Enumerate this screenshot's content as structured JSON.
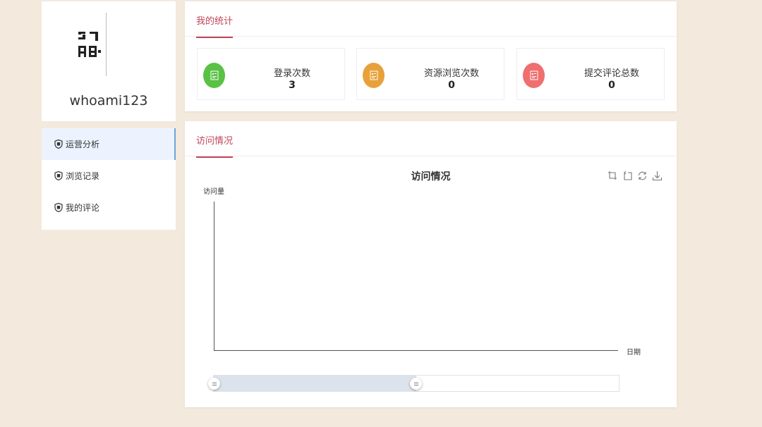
{
  "profile": {
    "username": "whoami123",
    "avatar_icon": "qr-avatar-icon"
  },
  "menu": {
    "items": [
      {
        "label": "运营分析",
        "icon": "shield-icon",
        "active": true
      },
      {
        "label": "浏览记录",
        "icon": "shield-icon",
        "active": false
      },
      {
        "label": "我的评论",
        "icon": "shield-icon",
        "active": false
      }
    ]
  },
  "stats": {
    "tab_label": "我的统计",
    "cards": [
      {
        "label": "登录次数",
        "value": "3",
        "color": "#59c144",
        "icon": "calendar-icon"
      },
      {
        "label": "资源浏览次数",
        "value": "0",
        "color": "#e8a13a",
        "icon": "calendar-icon"
      },
      {
        "label": "提交评论总数",
        "value": "0",
        "color": "#ef6e6e",
        "icon": "calendar-icon"
      }
    ]
  },
  "visits": {
    "tab_label": "访问情况",
    "toolbox": [
      "zoom-icon",
      "zoom-reset-icon",
      "restore-icon",
      "download-icon"
    ]
  },
  "chart_data": {
    "type": "line",
    "title": "访问情况",
    "ylabel": "访问量",
    "xlabel": "日期",
    "categories": [],
    "series": [],
    "grid": false,
    "zoom_range": [
      0,
      0.5
    ]
  },
  "colors": {
    "accent": "#c1455a",
    "active_menu_bg": "#ecf3ff",
    "page_bg": "#f3e9dd"
  }
}
